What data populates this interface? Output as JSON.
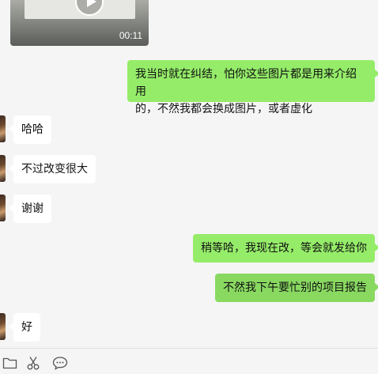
{
  "chat": {
    "video": {
      "duration": "00:11"
    },
    "messages": [
      {
        "side": "right",
        "text_line1": "我当时就在纠结，怕你这些图片都是用来介绍用",
        "text_line2": "的，不然我都会换成图片，或者虚化"
      },
      {
        "side": "left",
        "text": "哈哈"
      },
      {
        "side": "left",
        "text": "不过改变很大"
      },
      {
        "side": "left",
        "text": "谢谢"
      },
      {
        "side": "right",
        "text": "稍等哈，我现在改，等会就发给你"
      },
      {
        "side": "right",
        "text": "不然我下午要忙别的项目报告"
      },
      {
        "side": "left",
        "text": "好"
      }
    ]
  },
  "toolbar": {
    "icons": [
      "folder-icon",
      "scissors-icon",
      "chat-bubble-icon"
    ]
  },
  "colors": {
    "background": "#f5f5f5",
    "bubble_self": "#95ec69",
    "bubble_other": "#ffffff"
  }
}
